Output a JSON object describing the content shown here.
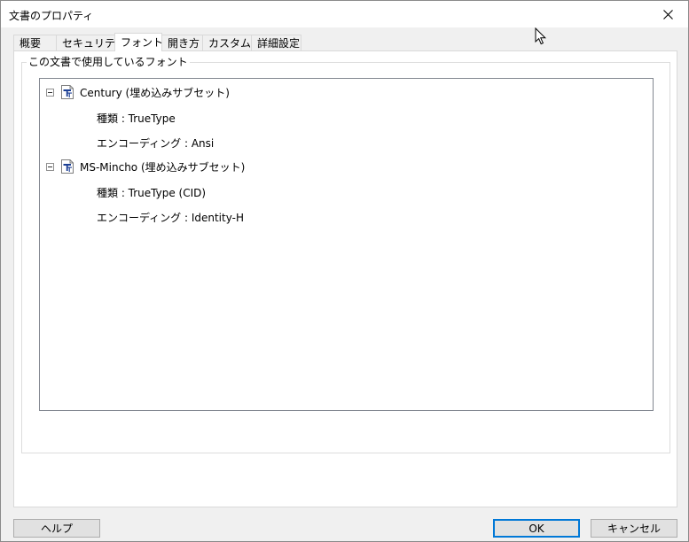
{
  "window": {
    "title": "文書のプロパティ"
  },
  "tabs": [
    {
      "label": "概要",
      "active": false
    },
    {
      "label": "セキュリティ",
      "active": false
    },
    {
      "label": "フォント",
      "active": true
    },
    {
      "label": "開き方",
      "active": false
    },
    {
      "label": "カスタム",
      "active": false
    },
    {
      "label": "詳細設定",
      "active": false
    }
  ],
  "fonts_group": {
    "legend": "この文書で使用しているフォント",
    "fonts": [
      {
        "name": "Century (埋め込みサブセット)",
        "type_label": "種類 : TrueType",
        "encoding_label": "エンコーディング : Ansi"
      },
      {
        "name": "MS-Mincho (埋め込みサブセット)",
        "type_label": "種類 : TrueType (CID)",
        "encoding_label": "エンコーディング : Identity-H"
      }
    ]
  },
  "buttons": {
    "help": "ヘルプ",
    "ok": "OK",
    "cancel": "キャンセル"
  },
  "icons": {
    "close": "close-icon",
    "font": "truetype-font-icon",
    "collapse": "collapse-toggle-icon",
    "cursor": "mouse-cursor-icon"
  }
}
